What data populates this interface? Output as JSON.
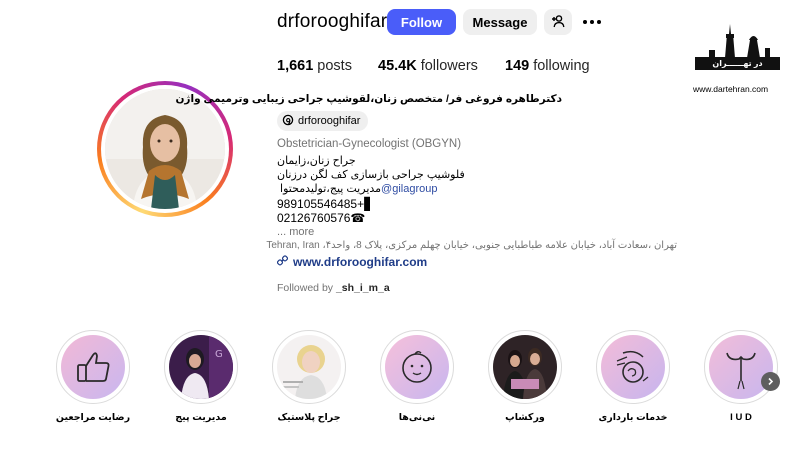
{
  "profile": {
    "username": "drforooghifar",
    "follow_label": "Follow",
    "message_label": "Message",
    "stats": {
      "posts_count": "1,661",
      "posts_label": "posts",
      "followers_count": "45.4K",
      "followers_label": "followers",
      "following_count": "149",
      "following_label": "following"
    },
    "full_name": "دکترطاهره فروغی فر/ متخصص زنان،لقوشیپ جراحی زیبایی وترمیمی واژن",
    "threads_handle": "drforooghifar",
    "bio": {
      "category": "Obstetrician-Gynecologist (OBGYN)",
      "line1": "جراح زنان،زایمان",
      "line2": "فلوشیپ جراحی بازسازی کف لگن درزنان",
      "line3_text": "مدیریت پیج،تولیدمحتوا ",
      "line3_link": "@gilagroup",
      "phone1": "989105546485+▋",
      "phone2": "02126760576☎",
      "more": "... more",
      "address": "تهران ،سعادت آباد، خیابان علامه طباطبایی جنوبی، خیابان چهلم مرکزی، پلاک 8، واحد۴، Tehran, Iran",
      "website": "www.drforooghifar.com"
    },
    "followed_by_prefix": "Followed by",
    "followed_by_user": "_sh_i_m_a"
  },
  "watermark": {
    "band_text": "در تهــــــران",
    "url": "www.dartehran.com"
  },
  "highlights": [
    {
      "label": "رضایت مراجعین",
      "icon": "thumbs-up-icon"
    },
    {
      "label": "مدیریت پیج",
      "icon": "page-photo"
    },
    {
      "label": "جراح پلاستیک",
      "icon": "portrait-photo"
    },
    {
      "label": "نی‌نی‌ها",
      "icon": "baby-face-icon"
    },
    {
      "label": "ورکشاپ",
      "icon": "workshop-photo"
    },
    {
      "label": "خدمات بارداری",
      "icon": "pregnancy-icon"
    },
    {
      "label": "I U D",
      "icon": "iud-icon"
    }
  ],
  "colors": {
    "follow_button": "#4a5df9",
    "secondary_button": "#efefef",
    "link": "#1f3c88"
  }
}
